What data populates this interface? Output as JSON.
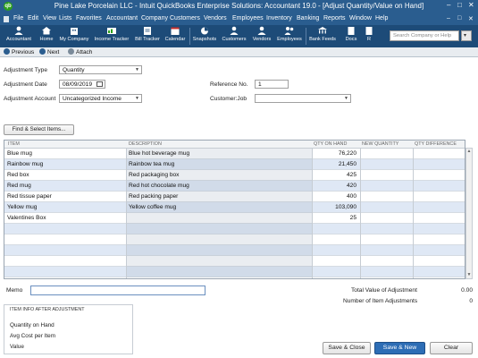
{
  "window": {
    "title": "Pine Lake Porcelain LLC  - Intuit QuickBooks Enterprise Solutions: Accountant 19.0 - [Adjust Quantity/Value on Hand]",
    "app_icon": "qb",
    "controls": [
      "–",
      "□",
      "✕"
    ]
  },
  "menu": [
    "File",
    "Edit",
    "View",
    "Lists",
    "Favorites",
    "Accountant",
    "Company",
    "Customers",
    "Vendors",
    "Employees",
    "Inventory",
    "Banking",
    "Reports",
    "Window",
    "Help"
  ],
  "menu_right": [
    "–",
    "□",
    "✕"
  ],
  "toolbar": {
    "items": [
      "Accountant",
      "Home",
      "My Company",
      "Income Tracker",
      "Bill Tracker",
      "Calendar",
      "Snapshots",
      "Customers",
      "Vendors",
      "Employees",
      "Bank Feeds",
      "Docs",
      "R"
    ],
    "search_placeholder": "Search Company or Help",
    "search_btn": "▾"
  },
  "nav": {
    "previous": "Previous",
    "next": "Next",
    "attach": "Attach"
  },
  "form": {
    "adjustment_type_label": "Adjustment Type",
    "adjustment_type_value": "Quantity",
    "adjustment_date_label": "Adjustment Date",
    "adjustment_date_value": "08/09/2019",
    "adjustment_account_label": "Adjustment Account",
    "adjustment_account_value": "Uncategorized Income",
    "reference_label": "Reference No.",
    "reference_value": "1",
    "customer_job_label": "Customer:Job",
    "customer_job_value": "",
    "find_button": "Find & Select Items..."
  },
  "table": {
    "headers": [
      "ITEM",
      "DESCRIPTION",
      "QTY ON HAND",
      "NEW QUANTITY",
      "QTY DIFFERENCE"
    ],
    "rows": [
      {
        "item": "Blue mug",
        "description": "Blue hot beverage mug",
        "qty": "76,220"
      },
      {
        "item": "Rainbow mug",
        "description": "Rainbow tea mug",
        "qty": "21,450"
      },
      {
        "item": "Red box",
        "description": "Red packaging box",
        "qty": "425"
      },
      {
        "item": "Red mug",
        "description": "Red hot chocolate mug",
        "qty": "420"
      },
      {
        "item": "Red tissue paper",
        "description": "Red packing paper",
        "qty": "400"
      },
      {
        "item": "Yellow mug",
        "description": "Yellow coffee mug",
        "qty": "103,090"
      },
      {
        "item": "Valentines Box",
        "description": "",
        "qty": "25"
      }
    ]
  },
  "memo": {
    "label": "Memo",
    "value": ""
  },
  "totals": {
    "value_label": "Total Value of Adjustment",
    "value": "0.00",
    "count_label": "Number of Item Adjustments",
    "count": "0"
  },
  "info": {
    "header": "ITEM INFO AFTER ADJUSTMENT",
    "qoh": "Quantity on Hand",
    "avg": "Avg Cost per Item",
    "value": "Value"
  },
  "buttons": {
    "save_close": "Save & Close",
    "save_new": "Save & New",
    "clear": "Clear"
  },
  "colors": {
    "title_blue": "#2a5d8f",
    "toolbar_blue": "#1d4b78",
    "row_alt": "#dfe8f5",
    "primary_btn": "#2d6db5"
  }
}
